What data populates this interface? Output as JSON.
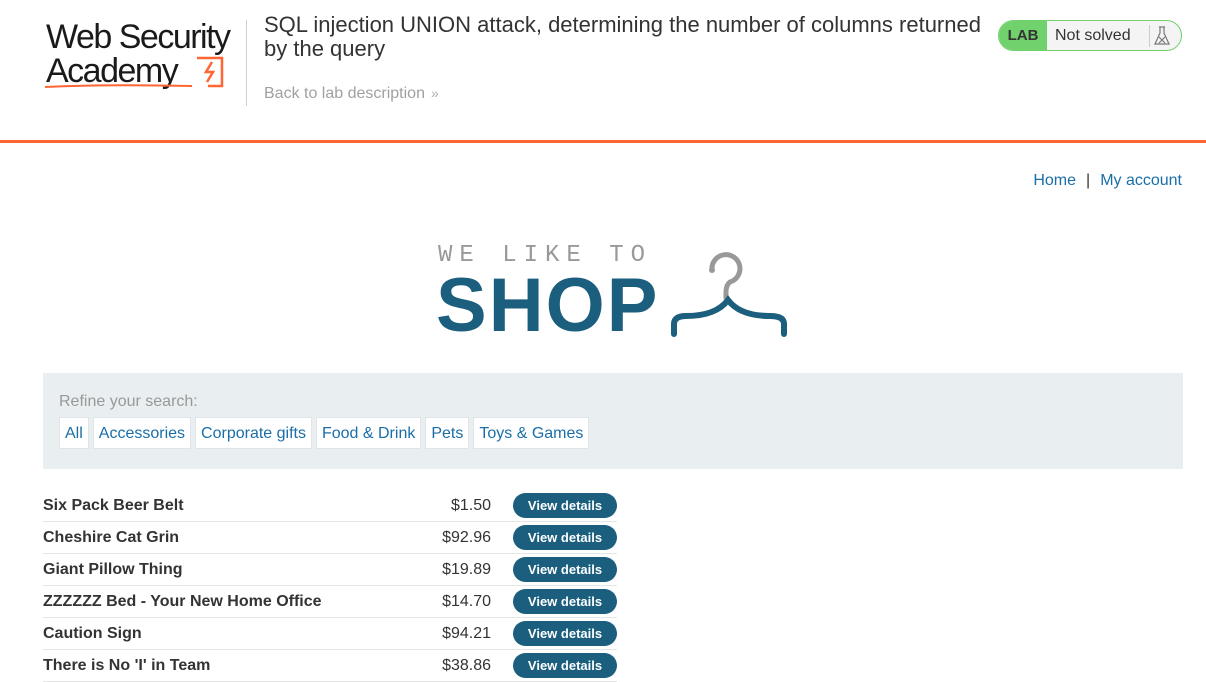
{
  "academy": {
    "logo_line1": "Web Security",
    "logo_line2": "Academy",
    "lab_title": "SQL injection UNION attack, determining the number of columns returned by the query",
    "back_link": "Back to lab description",
    "status_tag": "LAB",
    "status_text": "Not solved",
    "accent_color": "#ff6633",
    "status_color": "#70d16d"
  },
  "nav": {
    "home": "Home",
    "separator": "|",
    "my_account": "My account"
  },
  "shop_logo": {
    "tagline": "WE LIKE TO",
    "word": "SHOP",
    "icon": "hanger-icon"
  },
  "filters": {
    "label": "Refine your search:",
    "categories": [
      "All",
      "Accessories",
      "Corporate gifts",
      "Food & Drink",
      "Pets",
      "Toys & Games"
    ]
  },
  "products": [
    {
      "name": "Six Pack Beer Belt",
      "price": "$1.50",
      "action": "View details"
    },
    {
      "name": "Cheshire Cat Grin",
      "price": "$92.96",
      "action": "View details"
    },
    {
      "name": "Giant Pillow Thing",
      "price": "$19.89",
      "action": "View details"
    },
    {
      "name": "ZZZZZZ Bed - Your New Home Office",
      "price": "$14.70",
      "action": "View details"
    },
    {
      "name": "Caution Sign",
      "price": "$94.21",
      "action": "View details"
    },
    {
      "name": "There is No 'I' in Team",
      "price": "$38.86",
      "action": "View details"
    }
  ]
}
